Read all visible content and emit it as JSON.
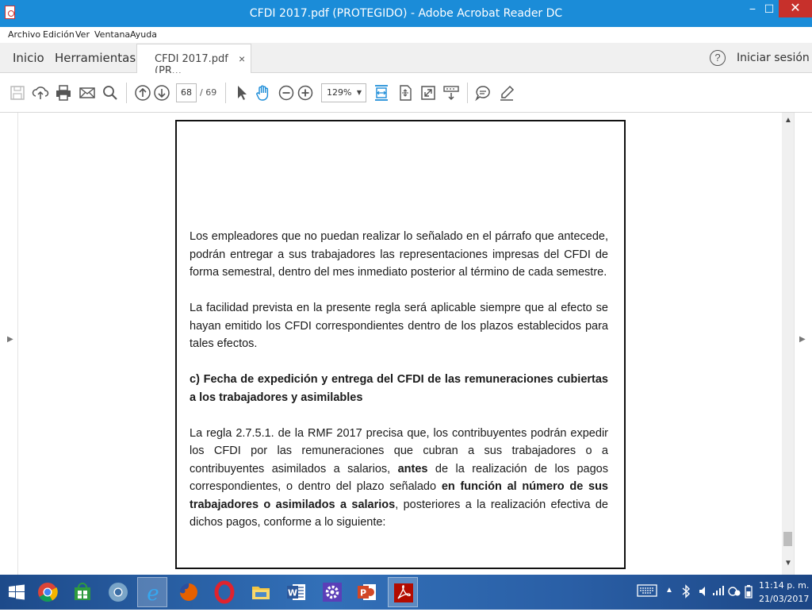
{
  "window": {
    "title": "CFDI 2017.pdf (PROTEGIDO) - Adobe Acrobat Reader DC",
    "minimize": "−",
    "maximize": "☐",
    "close": "✕"
  },
  "menu": [
    "Archivo",
    "Edición",
    "Ver",
    "Ventana",
    "Ayuda"
  ],
  "tabs": {
    "home": "Inicio",
    "tools": "Herramientas",
    "document": "CFDI 2017.pdf (PR...",
    "close": "×",
    "help": "?",
    "sign_in": "Iniciar sesión"
  },
  "toolbar": {
    "page_current": "68",
    "page_total": "/ 69",
    "zoom": "129%"
  },
  "document": {
    "paragraph1": "Los empleadores que no puedan realizar lo señalado en el párrafo que antecede, podrán entregar a sus trabajadores las representaciones impresas del CFDI de forma semestral, dentro del mes inmediato posterior al término de cada semestre.",
    "paragraph2": "La facilidad prevista en la presente regla será aplicable siempre que al efecto se hayan emitido los CFDI correspondientes dentro de los plazos establecidos para tales efectos.",
    "heading": "c) Fecha de expedición y entrega del CFDI de las remuneraciones cubiertas a los trabajadores y asimilables",
    "p3_part1": "La regla 2.7.5.1. de la RMF 2017 precisa que, los contribuyentes podrán expedir los CFDI por las remuneraciones que cubran a sus trabajadores o a contribuyentes asimilados a salarios, ",
    "p3_bold1": "antes",
    "p3_part2": " de la realización de los pagos correspondientes, o dentro del plazo señalado ",
    "p3_bold2": "en función al número de sus trabajadores o asimilados a salarios",
    "p3_part3": ", posteriores a la realización efectiva de dichos pagos, conforme a lo siguiente:"
  },
  "taskbar": {
    "clock_time": "11:14 p. m.",
    "clock_date": "21/03/2017"
  },
  "colors": {
    "titlebar": "#1b8cd8",
    "close": "#c7302b",
    "accent_icon": "#1b8cd8"
  }
}
